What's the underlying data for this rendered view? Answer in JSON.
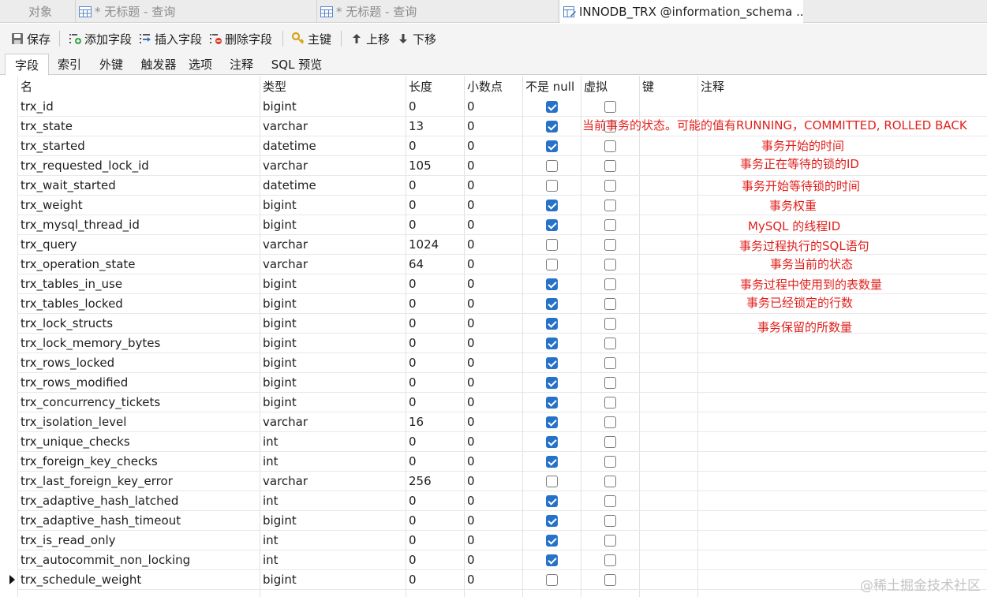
{
  "doc_tabs": [
    {
      "label": "对象",
      "icon": "objects-icon"
    },
    {
      "label": "* 无标题 - 查询",
      "icon": "query-table-icon"
    },
    {
      "label": "* 无标题 - 查询",
      "icon": "query-table-icon"
    },
    {
      "label": "INNODB_TRX @information_schema ...",
      "icon": "table-design-icon"
    }
  ],
  "toolbar": {
    "save": "保存",
    "add_field": "添加字段",
    "insert_field": "插入字段",
    "delete_field": "删除字段",
    "primary_key": "主键",
    "move_up": "上移",
    "move_down": "下移"
  },
  "sub_tabs": [
    "字段",
    "索引",
    "外键",
    "触发器",
    "选项",
    "注释",
    "SQL 预览"
  ],
  "table": {
    "columns": [
      "名",
      "类型",
      "长度",
      "小数点",
      "不是 null",
      "虚拟",
      "键",
      "注释"
    ],
    "rows": [
      {
        "name": "trx_id",
        "type": "bigint",
        "length": "0",
        "decimals": "0",
        "not_null": true,
        "virtual": false
      },
      {
        "name": "trx_state",
        "type": "varchar",
        "length": "13",
        "decimals": "0",
        "not_null": true,
        "virtual": false
      },
      {
        "name": "trx_started",
        "type": "datetime",
        "length": "0",
        "decimals": "0",
        "not_null": true,
        "virtual": false
      },
      {
        "name": "trx_requested_lock_id",
        "type": "varchar",
        "length": "105",
        "decimals": "0",
        "not_null": false,
        "virtual": false
      },
      {
        "name": "trx_wait_started",
        "type": "datetime",
        "length": "0",
        "decimals": "0",
        "not_null": false,
        "virtual": false
      },
      {
        "name": "trx_weight",
        "type": "bigint",
        "length": "0",
        "decimals": "0",
        "not_null": true,
        "virtual": false
      },
      {
        "name": "trx_mysql_thread_id",
        "type": "bigint",
        "length": "0",
        "decimals": "0",
        "not_null": true,
        "virtual": false
      },
      {
        "name": "trx_query",
        "type": "varchar",
        "length": "1024",
        "decimals": "0",
        "not_null": false,
        "virtual": false
      },
      {
        "name": "trx_operation_state",
        "type": "varchar",
        "length": "64",
        "decimals": "0",
        "not_null": false,
        "virtual": false
      },
      {
        "name": "trx_tables_in_use",
        "type": "bigint",
        "length": "0",
        "decimals": "0",
        "not_null": true,
        "virtual": false
      },
      {
        "name": "trx_tables_locked",
        "type": "bigint",
        "length": "0",
        "decimals": "0",
        "not_null": true,
        "virtual": false
      },
      {
        "name": "trx_lock_structs",
        "type": "bigint",
        "length": "0",
        "decimals": "0",
        "not_null": true,
        "virtual": false
      },
      {
        "name": "trx_lock_memory_bytes",
        "type": "bigint",
        "length": "0",
        "decimals": "0",
        "not_null": true,
        "virtual": false
      },
      {
        "name": "trx_rows_locked",
        "type": "bigint",
        "length": "0",
        "decimals": "0",
        "not_null": true,
        "virtual": false
      },
      {
        "name": "trx_rows_modified",
        "type": "bigint",
        "length": "0",
        "decimals": "0",
        "not_null": true,
        "virtual": false
      },
      {
        "name": "trx_concurrency_tickets",
        "type": "bigint",
        "length": "0",
        "decimals": "0",
        "not_null": true,
        "virtual": false
      },
      {
        "name": "trx_isolation_level",
        "type": "varchar",
        "length": "16",
        "decimals": "0",
        "not_null": true,
        "virtual": false
      },
      {
        "name": "trx_unique_checks",
        "type": "int",
        "length": "0",
        "decimals": "0",
        "not_null": true,
        "virtual": false
      },
      {
        "name": "trx_foreign_key_checks",
        "type": "int",
        "length": "0",
        "decimals": "0",
        "not_null": true,
        "virtual": false
      },
      {
        "name": "trx_last_foreign_key_error",
        "type": "varchar",
        "length": "256",
        "decimals": "0",
        "not_null": false,
        "virtual": false
      },
      {
        "name": "trx_adaptive_hash_latched",
        "type": "int",
        "length": "0",
        "decimals": "0",
        "not_null": true,
        "virtual": false
      },
      {
        "name": "trx_adaptive_hash_timeout",
        "type": "bigint",
        "length": "0",
        "decimals": "0",
        "not_null": true,
        "virtual": false
      },
      {
        "name": "trx_is_read_only",
        "type": "int",
        "length": "0",
        "decimals": "0",
        "not_null": true,
        "virtual": false
      },
      {
        "name": "trx_autocommit_non_locking",
        "type": "int",
        "length": "0",
        "decimals": "0",
        "not_null": true,
        "virtual": false
      },
      {
        "name": "trx_schedule_weight",
        "type": "bigint",
        "length": "0",
        "decimals": "0",
        "not_null": false,
        "virtual": false
      }
    ]
  },
  "annotations": [
    "当前事务的状态。可能的值有RUNNING，COMMITTED, ROLLED BACK",
    "事务开始的时间",
    "事务正在等待的锁的ID",
    "事务开始等待锁的时间",
    "事务权重",
    "MySQL 的线程ID",
    "事务过程执行的SQL语句",
    "事务当前的状态",
    "事务过程中使用到的表数量",
    "事务已经锁定的行数",
    "事务保留的所数量"
  ],
  "watermark": "@稀土掘金技术社区",
  "colors": {
    "checkbox_checked": "#2672c8",
    "annotation": "#e0201c",
    "toolbar_bg": "#f4f4f4"
  }
}
